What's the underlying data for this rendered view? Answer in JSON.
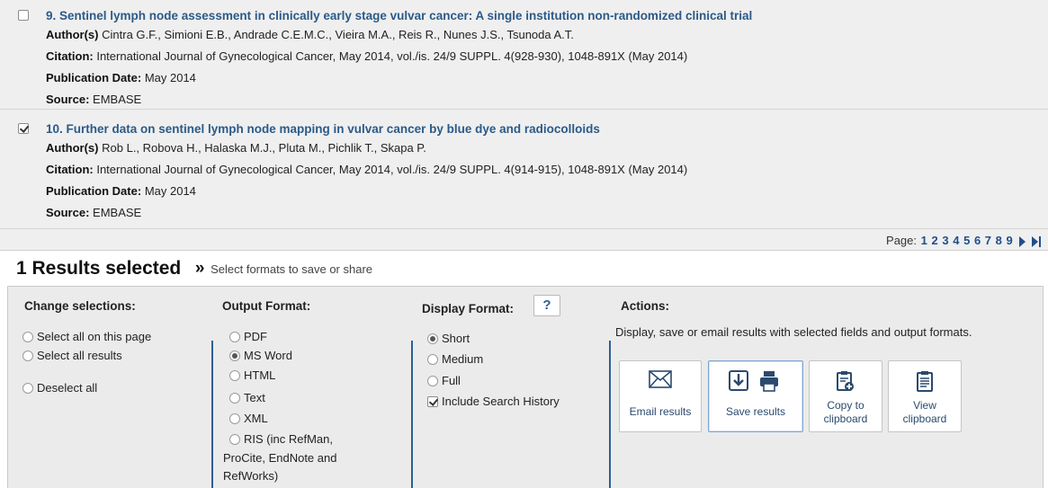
{
  "records": [
    {
      "number_title": "9. Sentinel lymph node assessment in clinically early stage vulvar cancer: A single institution non-randomized clinical trial",
      "checked": false,
      "authors_label": "Author(s)",
      "authors": "Cintra G.F., Simioni E.B., Andrade C.E.M.C., Vieira M.A., Reis R., Nunes J.S., Tsunoda A.T.",
      "citation_label": "Citation:",
      "citation": "International Journal of Gynecological Cancer, May 2014, vol./is. 24/9 SUPPL. 4(928-930), 1048-891X (May 2014)",
      "pubdate_label": "Publication Date:",
      "pubdate": "May 2014",
      "source_label": "Source:",
      "source": "EMBASE"
    },
    {
      "number_title": "10. Further data on sentinel lymph node mapping in vulvar cancer by blue dye and radiocolloids",
      "checked": true,
      "authors_label": "Author(s)",
      "authors": "Rob L., Robova H., Halaska M.J., Pluta M., Pichlik T., Skapa P.",
      "citation_label": "Citation:",
      "citation": "International Journal of Gynecological Cancer, May 2014, vol./is. 24/9 SUPPL. 4(914-915), 1048-891X (May 2014)",
      "pubdate_label": "Publication Date:",
      "pubdate": "May 2014",
      "source_label": "Source:",
      "source": "EMBASE"
    }
  ],
  "pager": {
    "label": "Page:",
    "pages": [
      "1",
      "2",
      "3",
      "4",
      "5",
      "6",
      "7",
      "8",
      "9"
    ]
  },
  "selection": {
    "count_text": "1 Results selected",
    "arrows": "»",
    "hint": "Select formats to save or share"
  },
  "change_selections": {
    "heading": "Change selections:",
    "options": [
      "Select all on this page",
      "Select all results",
      "Deselect all"
    ]
  },
  "output_format": {
    "heading": "Output Format:",
    "selected": "MS Word",
    "options": [
      "PDF",
      "MS Word",
      "HTML",
      "Text",
      "XML",
      "RIS (inc RefMan,",
      "ProCite, EndNote and",
      "RefWorks)"
    ]
  },
  "display_format": {
    "heading": "Display Format:",
    "help_label": "?",
    "selected": "Short",
    "options": [
      "Short",
      "Medium",
      "Full"
    ],
    "include_history_label": "Include Search History",
    "include_history_checked": true
  },
  "actions": {
    "heading": "Actions:",
    "description": "Display, save or email results with selected fields and output formats.",
    "buttons": [
      {
        "label": "Email results",
        "icon": "envelope-icon"
      },
      {
        "label": "Save results",
        "icon": "download-print-icon"
      },
      {
        "label_line1": "Copy to",
        "label_line2": "clipboard",
        "icon": "clipboard-add-icon"
      },
      {
        "label_line1": "View",
        "label_line2": "clipboard",
        "icon": "clipboard-view-icon"
      }
    ]
  },
  "colors": {
    "link": "#2b5a88",
    "accent_divider": "#2c5f93",
    "panel_bg": "#ebebeb",
    "results_bg": "#efefef"
  }
}
